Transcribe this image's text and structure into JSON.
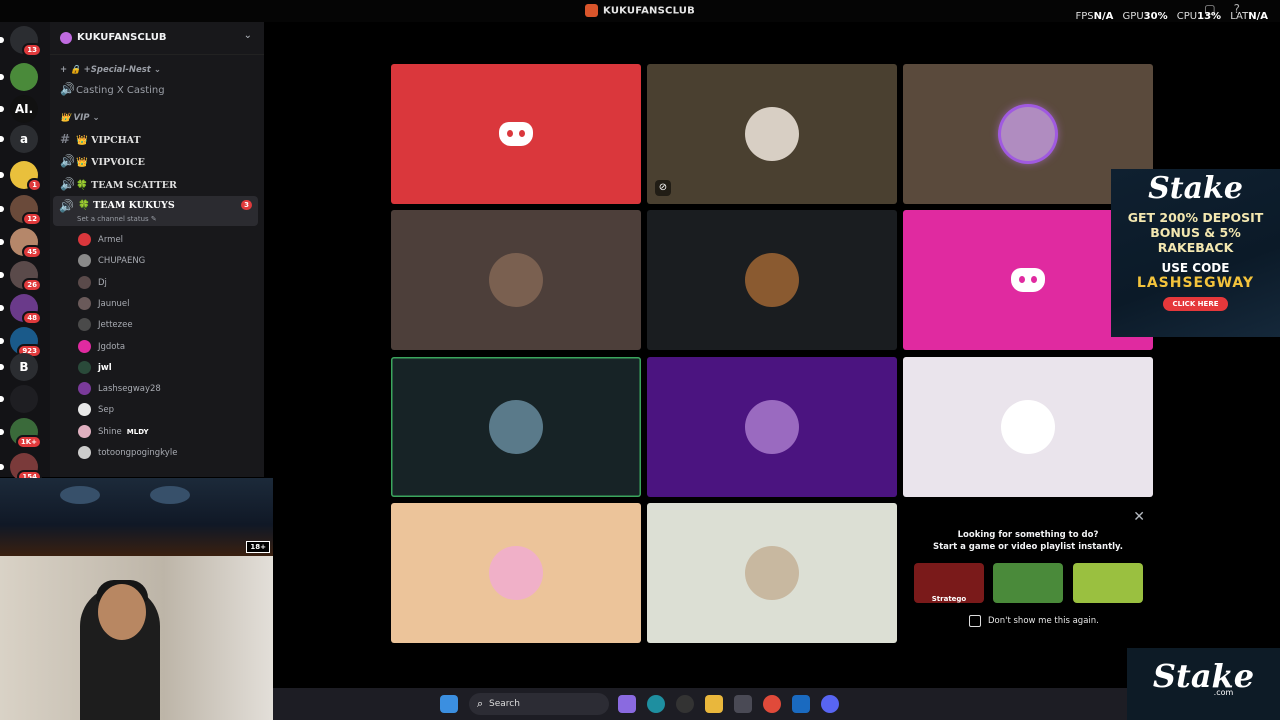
{
  "window": {
    "title": "KUKUFANSCLUB",
    "perf": {
      "fps_label": "FPS",
      "fps": "N/A",
      "gpu_label": "GPU",
      "gpu": "30%",
      "cpu_label": "CPU",
      "cpu": "13%",
      "lat_label": "LAT",
      "lat": "N/A"
    }
  },
  "guilds": [
    {
      "icon": "discord-home-icon",
      "badge": "13",
      "color": "#2b2d31"
    },
    {
      "icon": "pepe-server-icon",
      "badge": "",
      "color": "#4a8a3a"
    },
    {
      "icon": "ai-server-icon",
      "text": "AI.",
      "badge": "",
      "color": "#111111"
    },
    {
      "text": "a",
      "badge": "",
      "color": "#2b2d31"
    },
    {
      "icon": "pikachu-server-icon",
      "badge": "1",
      "color": "#e9c03c"
    },
    {
      "icon": "inday-server-icon",
      "badge": "12",
      "color": "#6a4a3a"
    },
    {
      "icon": "avatar-server-icon",
      "badge": "45",
      "color": "#b5876a"
    },
    {
      "icon": "avatar-server-icon",
      "badge": "26",
      "color": "#5a4a4a"
    },
    {
      "icon": "anime-server-icon",
      "badge": "48",
      "color": "#6a3a8a"
    },
    {
      "icon": "team-server-icon",
      "badge": "923",
      "color": "#1a5a8a"
    },
    {
      "text": "B",
      "badge": "",
      "color": "#2b2d31"
    },
    {
      "icon": "red-logo-server-icon",
      "badge": "",
      "color": "#1e1e22"
    },
    {
      "icon": "avatar-server-icon",
      "badge": "1K+",
      "color": "#3a6a3a"
    },
    {
      "icon": "avatar-server-icon",
      "badge": "154",
      "color": "#7a3a3a"
    }
  ],
  "server": {
    "name": "KUKUFANSCLUB"
  },
  "categories": {
    "special": "+Special-Nest",
    "vip": "VIP"
  },
  "channels": {
    "casting": "Casting X Casting",
    "vipchat": "VIPCHAT",
    "vipvoice": "VIPVOICE",
    "scatter": "TEAM SCATTER",
    "kukuys": "TEAM KUKUYS",
    "kukuys_badge": "3",
    "kukuys_status": "Set a channel status"
  },
  "members": [
    {
      "name": "Armel",
      "color": "#da373c"
    },
    {
      "name": "CHUPAENG",
      "color": "#8a8a8a"
    },
    {
      "name": "Dj",
      "color": "#5a4a4a"
    },
    {
      "name": "Jaunuel",
      "color": "#6a5a5a"
    },
    {
      "name": "Jettezee",
      "color": "#4a4a4a"
    },
    {
      "name": "Jgdota",
      "color": "#e02aa0"
    },
    {
      "name": "jwl",
      "color": "#2a4a3a",
      "bold": true
    },
    {
      "name": "Lashsegway28",
      "color": "#7a3a9a"
    },
    {
      "name": "Sep",
      "color": "#e8e8e8"
    },
    {
      "name": "Shine",
      "color": "#e0b0c0",
      "tag": "MLDY"
    },
    {
      "name": "totoongpogingkyle",
      "color": "#cccccc"
    }
  ],
  "stream": {
    "rating": "18+"
  },
  "tiles": [
    {
      "bg": "#da373c",
      "kind": "discord-red"
    },
    {
      "bg": "#4a4030",
      "kind": "avatar",
      "avatar": "#d8cfc4",
      "muted": true
    },
    {
      "bg": "#5a4a3c",
      "kind": "avatar",
      "avatar": "#b08cc0",
      "ring": true
    },
    {
      "bg": "#4d3f3a",
      "kind": "avatar",
      "avatar": "#7a6050"
    },
    {
      "bg": "#1a1d20",
      "kind": "avatar",
      "avatar": "#8a5a30"
    },
    {
      "bg": "#e02aa0",
      "kind": "discord-pink"
    },
    {
      "bg": "#172326",
      "kind": "avatar",
      "avatar": "#5a7a8a",
      "speaking": true
    },
    {
      "bg": "#4b1480",
      "kind": "avatar",
      "avatar": "#9a6ac0"
    },
    {
      "bg": "#eae4ec",
      "kind": "avatar",
      "avatar": "#ffffff"
    },
    {
      "bg": "#ecc49a",
      "kind": "avatar",
      "avatar": "#f0b0c8"
    },
    {
      "bg": "#dcdfd4",
      "kind": "avatar",
      "avatar": "#c8b8a0"
    }
  ],
  "suggestion": {
    "line1": "Looking for something to do?",
    "line2": "Start a game or video playlist instantly.",
    "games": [
      {
        "name": "Stratego",
        "color": "#7a1a1a"
      },
      {
        "name": "",
        "color": "#4a8a3a"
      },
      {
        "name": "",
        "color": "#9ac040"
      }
    ],
    "dont_show": "Don't show me this again."
  },
  "ad": {
    "brand": "Stake",
    "offer_line1": "GET 200% DEPOSIT",
    "offer_line2": "BONUS & 5%",
    "offer_line3": "RAKEBACK",
    "code_label": "USE CODE",
    "code": "LASHSEGWAY",
    "cta": "CLICK HERE"
  },
  "logo": {
    "brand": "Stake",
    "sub": ".com"
  },
  "taskbar": {
    "search_label": "Search"
  }
}
